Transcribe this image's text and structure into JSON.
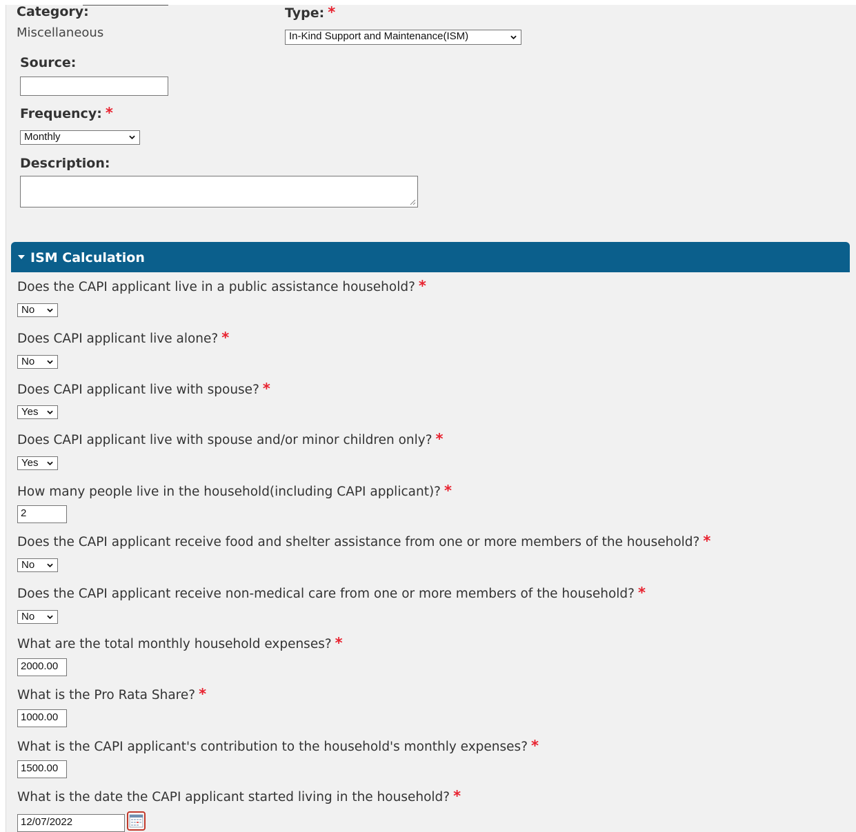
{
  "form": {
    "category": {
      "label": "Category:",
      "value": "Miscellaneous"
    },
    "type": {
      "label": "Type:",
      "required": "*",
      "selected": "In-Kind Support and Maintenance(ISM)"
    },
    "source": {
      "label": "Source:",
      "value": ""
    },
    "frequency": {
      "label": "Frequency:",
      "required": "*",
      "selected": "Monthly"
    },
    "description": {
      "label": "Description:",
      "value": ""
    }
  },
  "ism": {
    "title": "ISM Calculation",
    "questions": [
      {
        "text": "Does the CAPI applicant live in a public assistance household?",
        "required": "*",
        "control": "select",
        "value": "No"
      },
      {
        "text": "Does CAPI applicant live alone?",
        "required": "*",
        "control": "select",
        "value": "No"
      },
      {
        "text": "Does CAPI applicant live with spouse?",
        "required": "*",
        "control": "select",
        "value": "Yes"
      },
      {
        "text": "Does CAPI applicant live with spouse and/or minor children only?",
        "required": "*",
        "control": "select",
        "value": "Yes"
      },
      {
        "text": "How many people live in the household(including CAPI applicant)?",
        "required": "*",
        "control": "input",
        "value": "2"
      },
      {
        "text": "Does the CAPI applicant receive food and shelter assistance from one or more members of the household?",
        "required": "*",
        "control": "select",
        "value": "No"
      },
      {
        "text": "Does the CAPI applicant receive non-medical care from one or more members of the household?",
        "required": "*",
        "control": "select",
        "value": "No"
      },
      {
        "text": "What are the total monthly household expenses?",
        "required": "*",
        "control": "input",
        "value": "2000.00"
      },
      {
        "text": "What is the Pro Rata Share?",
        "required": "*",
        "control": "input",
        "value": "1000.00"
      },
      {
        "text": "What is the CAPI applicant's contribution to the household's monthly expenses?",
        "required": "*",
        "control": "input",
        "value": "1500.00"
      },
      {
        "text": "What is the date the CAPI applicant started living in the household?",
        "required": "*",
        "control": "date",
        "value": "12/07/2022"
      }
    ]
  },
  "icons": {
    "calendar": "calendar-icon",
    "chevron": "chevron-down-icon",
    "caret": "caret-down-icon"
  },
  "colors": {
    "header": "#0b5f8c",
    "required": "#e8222f",
    "panel": "#f1f1f1"
  }
}
